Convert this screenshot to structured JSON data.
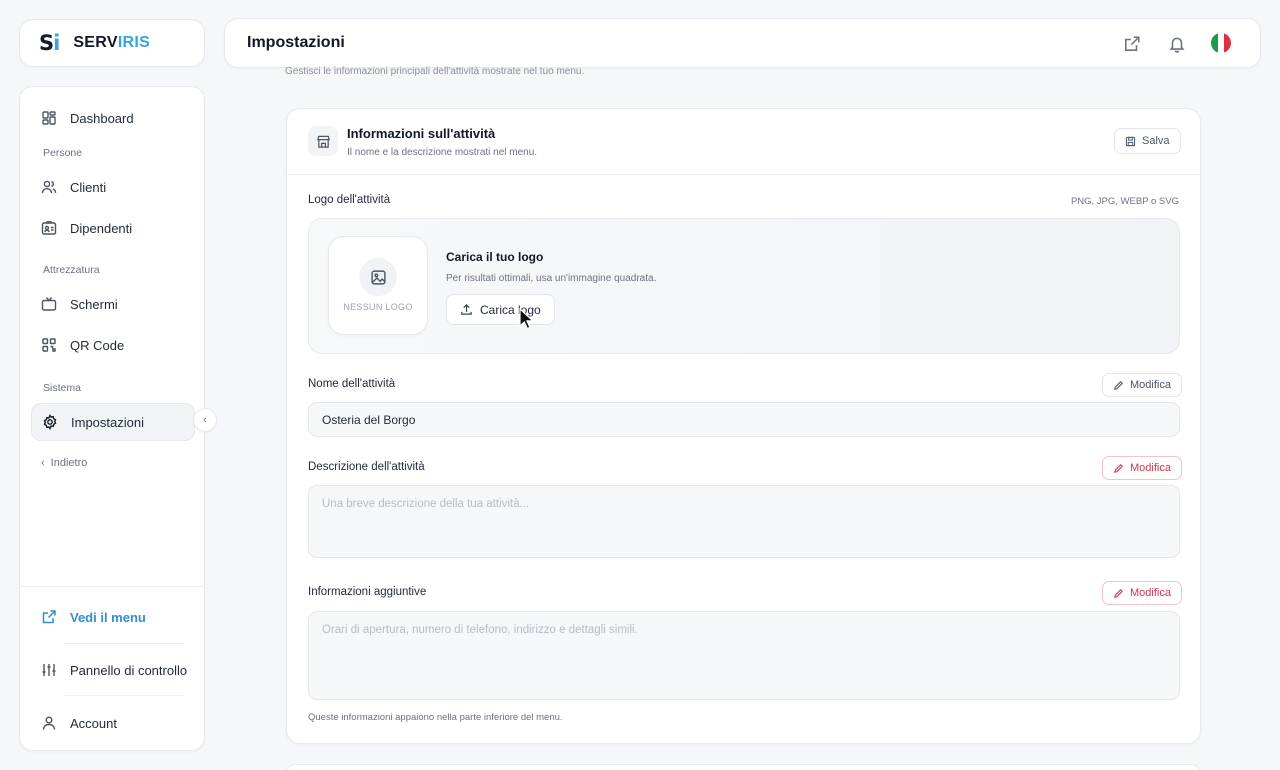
{
  "brand": {
    "mark_s": "S",
    "mark_i": "i",
    "name_a": "SERV",
    "name_b": "IRIS"
  },
  "sidebar": {
    "items": [
      {
        "label": "Dashboard",
        "icon": "dashboard-icon"
      },
      {
        "label": "Clienti",
        "icon": "users-icon"
      },
      {
        "label": "Dipendenti",
        "icon": "id-card-icon"
      },
      {
        "label": "Schermi",
        "icon": "tv-icon"
      },
      {
        "label": "QR Code",
        "icon": "qr-code-icon"
      },
      {
        "label": "Impostazioni",
        "icon": "gear-icon",
        "active": true
      }
    ],
    "sections": [
      "Persone",
      "Attrezzatura",
      "Sistema"
    ],
    "back_label": "Indietro",
    "bottom": [
      {
        "label": "Vedi il menu",
        "icon": "external-link-icon"
      },
      {
        "label": "Pannello di controllo",
        "icon": "sliders-icon"
      },
      {
        "label": "Account",
        "icon": "user-icon"
      }
    ]
  },
  "header": {
    "title": "Impostazioni",
    "icons": [
      "external-link-icon",
      "bell-icon",
      "italy-flag-icon"
    ]
  },
  "page": {
    "subtitle": "Gestisci le informazioni principali dell'attività mostrate nel tuo menu."
  },
  "panel": {
    "title": "Informazioni sull'attività",
    "subtitle": "Il nome e la descrizione mostrati nel menu.",
    "save_label": "Salva",
    "logo": {
      "label": "Logo dell'attività",
      "formats": "PNG, JPG, WEBP o SVG",
      "placeholder": "NESSUN LOGO",
      "upload_title": "Carica il tuo logo",
      "upload_hint": "Per risultati ottimali, usa un'immagine quadrata.",
      "upload_button": "Carica logo"
    },
    "name": {
      "label": "Nome dell'attività",
      "value": "Osteria del Borgo",
      "edit_label": "Modifica"
    },
    "description": {
      "label": "Descrizione dell'attività",
      "placeholder": "Una breve descrizione della tua attività...",
      "edit_label": "Modifica"
    },
    "extra": {
      "label": "Informazioni aggiuntive",
      "placeholder": "Orari di apertura, numero di telefono, indirizzo e dettagli simili.",
      "edit_label": "Modifica",
      "note": "Queste informazioni appaiono nella parte inferiore del menu."
    }
  },
  "colors": {
    "accent": "#38a3e0",
    "danger": "#d03650",
    "flag": [
      "#1f9a48",
      "#ffffff",
      "#d9303b"
    ]
  }
}
